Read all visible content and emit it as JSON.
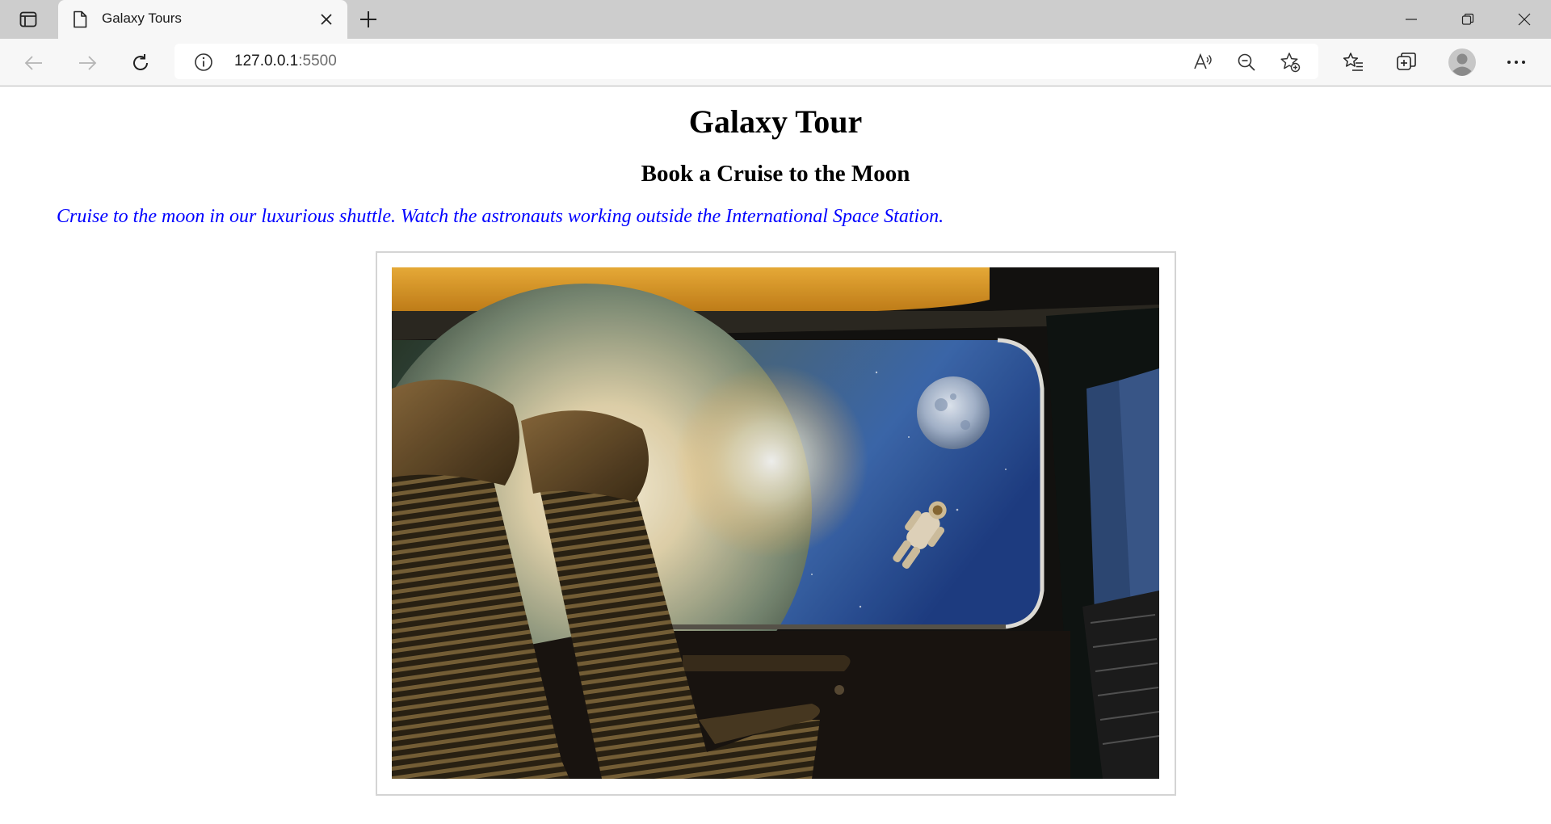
{
  "browser": {
    "tab": {
      "title": "Galaxy Tours"
    },
    "address": {
      "host": "127.0.0.1",
      "port": ":5500"
    }
  },
  "page": {
    "title": "Galaxy Tour",
    "subtitle": "Book a Cruise to the Moon",
    "intro": "Cruise to the moon in our luxurious shuttle. Watch the astronauts working outside the International Space Station."
  },
  "colors": {
    "intro_text": "#0000ff",
    "tabstrip": "#cdcdcd",
    "toolbar": "#f7f7f7"
  }
}
